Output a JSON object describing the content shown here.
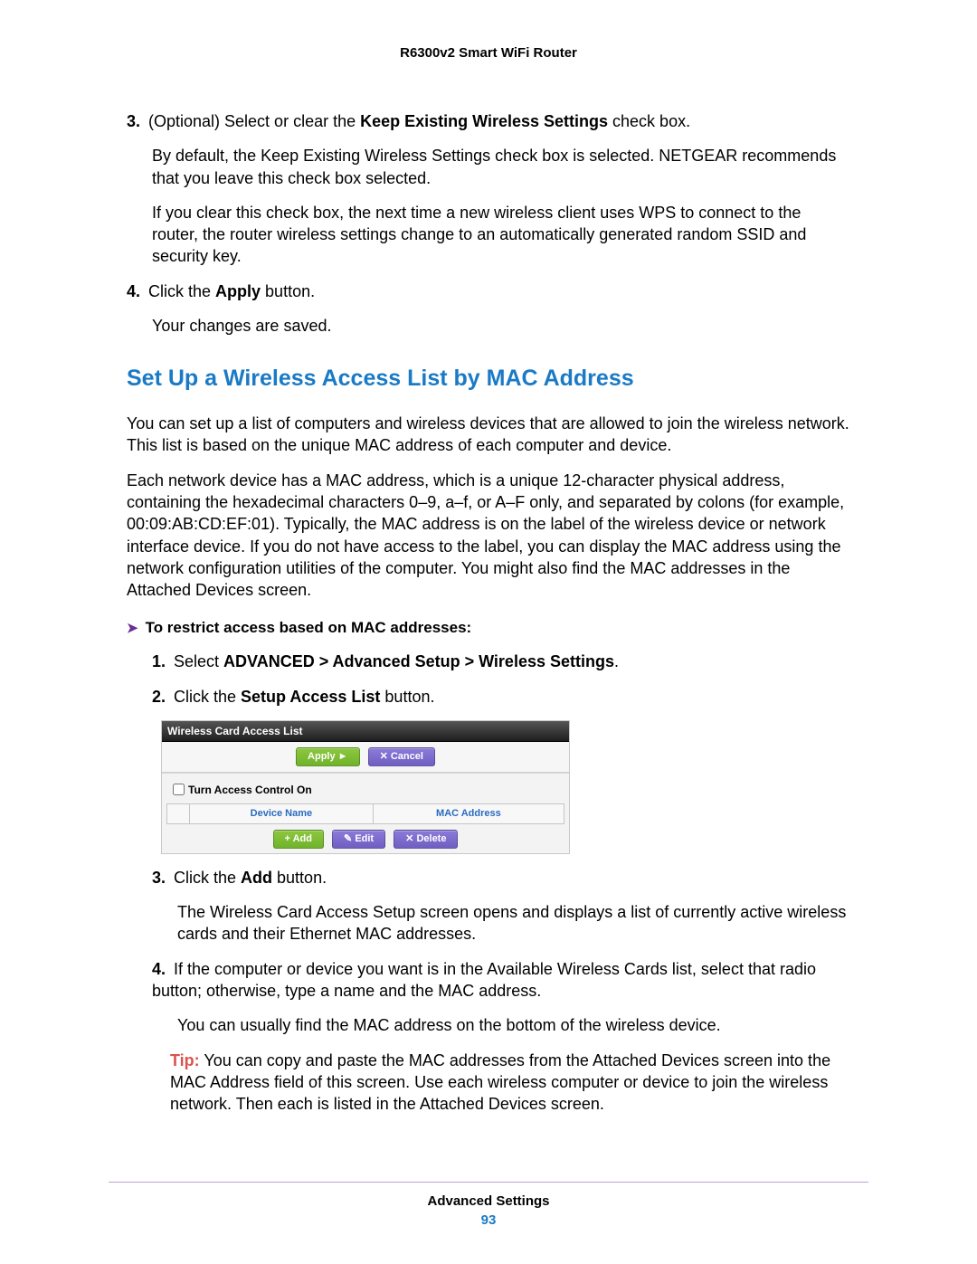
{
  "header": {
    "title": "R6300v2 Smart WiFi Router"
  },
  "body": {
    "step3_num": "3.",
    "step3_a": "(Optional) Select or clear the ",
    "step3_b": "Keep Existing Wireless Settings",
    "step3_c": " check box.",
    "step3_p2": "By default, the Keep Existing Wireless Settings check box is selected. NETGEAR recommends that you leave this check box selected.",
    "step3_p3": "If you clear this check box, the next time a new wireless client uses WPS to connect to the router, the router wireless settings change to an automatically generated random SSID and security key.",
    "step4_num": "4.",
    "step4_a": "Click the ",
    "step4_b": "Apply",
    "step4_c": " button.",
    "step4_p2": "Your changes are saved.",
    "h2": "Set Up a Wireless Access List by MAC Address",
    "p_h2_1": "You can set up a list of computers and wireless devices that are allowed to join the wireless network. This list is based on the unique MAC address of each computer and device.",
    "p_h2_2": "Each network device has a MAC address, which is a unique 12-character physical address, containing the hexadecimal characters 0–9, a–f, or A–F only, and separated by colons (for example, 00:09:AB:CD:EF:01). Typically, the MAC address is on the label of the wireless device or network interface device. If you do not have access to the label, you can display the MAC address using the network configuration utilities of the computer. You might also find the MAC addresses in the Attached Devices screen.",
    "bullet_arrow": "➤",
    "bullet_text": "To restrict access based on MAC addresses:",
    "s1_num": "1.",
    "s1_a": "Select ",
    "s1_b": "ADVANCED > Advanced Setup > Wireless Settings",
    "s1_c": ".",
    "s2_num": "2.",
    "s2_a": "Click the ",
    "s2_b": "Setup Access List",
    "s2_c": " button.",
    "s3_num": "3.",
    "s3_a": "Click the ",
    "s3_b": "Add",
    "s3_c": " button.",
    "s3_p2": "The Wireless Card Access Setup screen opens and displays a list of currently active wireless cards and their Ethernet MAC addresses.",
    "s4_num": "4.",
    "s4_text": "If the computer or device you want is in the Available Wireless Cards list, select that radio button; otherwise, type a name and the MAC address.",
    "s4_p2": "You can usually find the MAC address on the bottom of the wireless device.",
    "tip_label": "Tip:",
    "tip_text": " You can copy and paste the MAC addresses from the Attached Devices screen into the MAC Address field of this screen. Use each wireless computer or device to join the wireless network. Then each is listed in the Attached Devices screen."
  },
  "ui": {
    "title": "Wireless Card Access List",
    "apply": "Apply ►",
    "cancel": "✕ Cancel",
    "checkbox_label": "Turn Access Control On",
    "col_device": "Device Name",
    "col_mac": "MAC Address",
    "add": "+ Add",
    "edit": "✎ Edit",
    "delete": "✕ Delete"
  },
  "footer": {
    "section": "Advanced Settings",
    "page": "93"
  }
}
